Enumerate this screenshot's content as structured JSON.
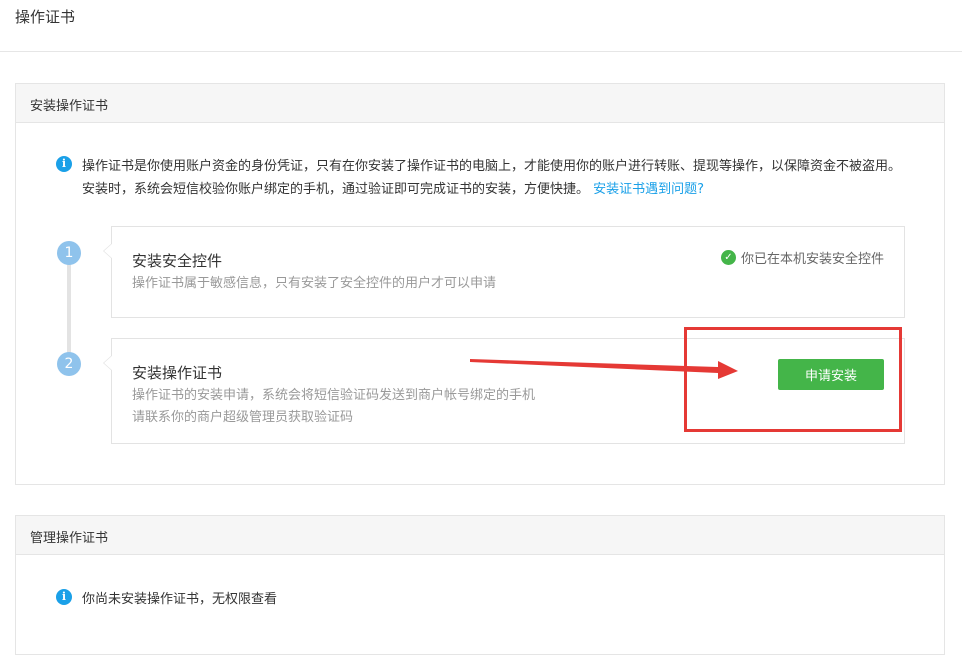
{
  "page": {
    "title": "操作证书"
  },
  "install_panel": {
    "title": "安装操作证书",
    "notice_text": "操作证书是你使用账户资金的身份凭证，只有在你安装了操作证书的电脑上，才能使用你的账户进行转账、提现等操作，以保障资金不被盗用。安装时，系统会短信校验你账户绑定的手机，通过验证即可完成证书的安装，方便快捷。",
    "notice_link": "安装证书遇到问题?",
    "steps": [
      {
        "number": "1",
        "title": "安装安全控件",
        "desc_lines": [
          "操作证书属于敏感信息，只有安装了安全控件的用户才可以申请"
        ],
        "status": "你已在本机安装安全控件"
      },
      {
        "number": "2",
        "title": "安装操作证书",
        "desc_lines": [
          "操作证书的安装申请，系统会将短信验证码发送到商户帐号绑定的手机",
          "请联系你的商户超级管理员获取验证码"
        ],
        "button_label": "申请安装"
      }
    ]
  },
  "manage_panel": {
    "title": "管理操作证书",
    "note": "你尚未安装操作证书，无权限查看"
  },
  "icons": {
    "info": "info-icon",
    "check": "check-circle-icon"
  },
  "colors": {
    "accent": "#1aa0e8",
    "success": "#44b549",
    "step": "#8fc3ec",
    "annotation": "#e53935"
  }
}
